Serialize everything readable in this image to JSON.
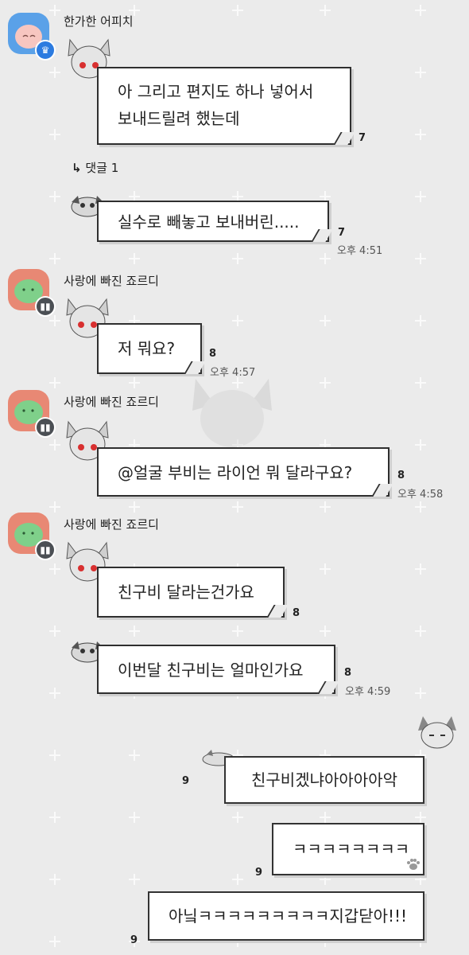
{
  "messages": [
    {
      "sender": "한가한 어피치",
      "lines": [
        "아 그리고 편지도 하나 넣어서",
        "보내드릴려 했는데"
      ],
      "count": "7",
      "time": ""
    },
    {
      "reply_label": "댓글 1"
    },
    {
      "text": "실수로 빼놓고 보내버린.....",
      "count": "7",
      "time": "오후 4:51"
    },
    {
      "sender": "사랑에 빠진 죠르디",
      "text": "저 뭐요?",
      "count": "8",
      "time": "오후 4:57"
    },
    {
      "sender": "사랑에 빠진 죠르디",
      "text": "@얼굴 부비는 라이언 뭐 달라구요?",
      "count": "8",
      "time": "오후 4:58"
    },
    {
      "sender": "사랑에 빠진 죠르디",
      "text": "친구비 달라는건가요",
      "count": "8",
      "time": ""
    },
    {
      "text": "이번달 친구비는 얼마인가요",
      "count": "8",
      "time": "오후 4:59"
    },
    {
      "text": "친구비겠냐아아아아악",
      "count": "9"
    },
    {
      "text": "ㅋㅋㅋㅋㅋㅋㅋㅋ",
      "count": "9"
    },
    {
      "text": "아닠ㅋㅋㅋㅋㅋㅋㅋㅋㅋ지갑닫아!!!",
      "count": "9"
    }
  ],
  "colors": {
    "background": "#ebebeb",
    "bubble_border": "#2f2f2f",
    "apeach_avatar": "#5aa1e8",
    "jordy_avatar": "#e88874"
  },
  "icons": {
    "reply": "reply-arrow-icon",
    "crown": "crown-icon",
    "member": "member-icon",
    "paw": "paw-icon"
  }
}
